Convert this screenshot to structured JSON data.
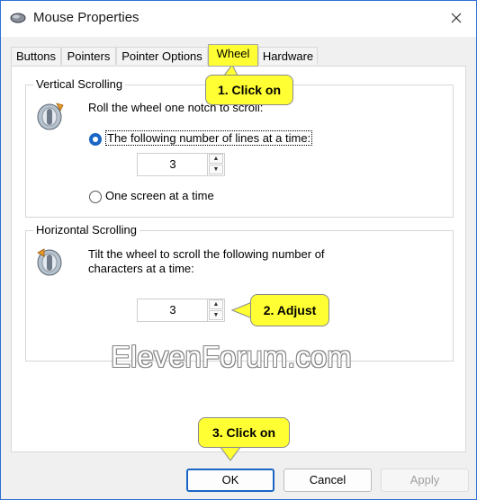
{
  "window": {
    "title": "Mouse Properties"
  },
  "tabs": [
    {
      "label": "Buttons"
    },
    {
      "label": "Pointers"
    },
    {
      "label": "Pointer Options"
    },
    {
      "label": "Wheel"
    },
    {
      "label": "Hardware"
    }
  ],
  "vertical": {
    "group_title": "Vertical Scrolling",
    "instruction": "Roll the wheel one notch to scroll:",
    "option_lines_label": "The following number of lines at a time:",
    "lines_value": "3",
    "option_screen_label": "One screen at a time",
    "selected_option": "lines"
  },
  "horizontal": {
    "group_title": "Horizontal Scrolling",
    "instruction_line1": "Tilt the wheel to scroll the following number of",
    "instruction_line2": "characters at a time:",
    "chars_value": "3"
  },
  "callouts": {
    "click_wheel": "1. Click on",
    "adjust": "2. Adjust",
    "click_ok": "3. Click on"
  },
  "watermark": "ElevenForum.com",
  "buttons": {
    "ok": "OK",
    "cancel": "Cancel",
    "apply": "Apply"
  },
  "colors": {
    "accent": "#1a66c4",
    "callout": "#ffff33",
    "tab_highlight": "#ffff33"
  }
}
